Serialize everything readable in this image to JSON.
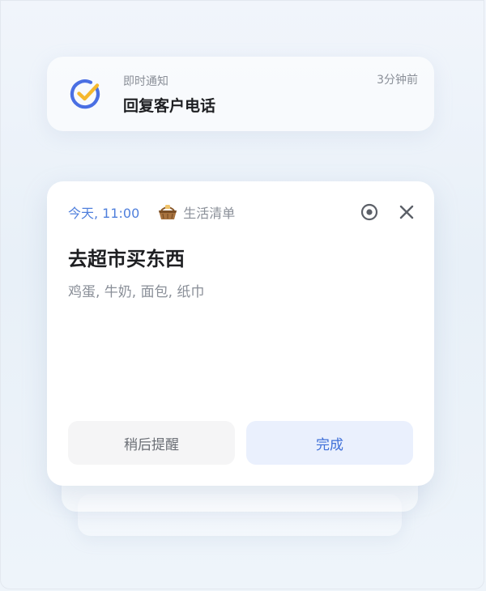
{
  "top_notification": {
    "app_name": "即时通知",
    "title": "回复客户电话",
    "time": "3分钟前",
    "icon": "check-circle-icon",
    "icon_colors": {
      "ring": "#4a6fe3",
      "check": "#f5b82e"
    }
  },
  "reminder_card": {
    "when": "今天, 11:00",
    "list_icon": "basket-icon",
    "list_name": "生活清单",
    "title": "去超市买东西",
    "description": "鸡蛋, 牛奶, 面包, 纸巾",
    "actions": {
      "snooze_label": "稍后提醒",
      "done_label": "完成"
    },
    "header_icons": [
      "target-icon",
      "close-icon"
    ]
  },
  "colors": {
    "accent": "#4f7fdc",
    "done_button_bg": "#eaf0fd",
    "snooze_button_bg": "#f5f5f6"
  }
}
